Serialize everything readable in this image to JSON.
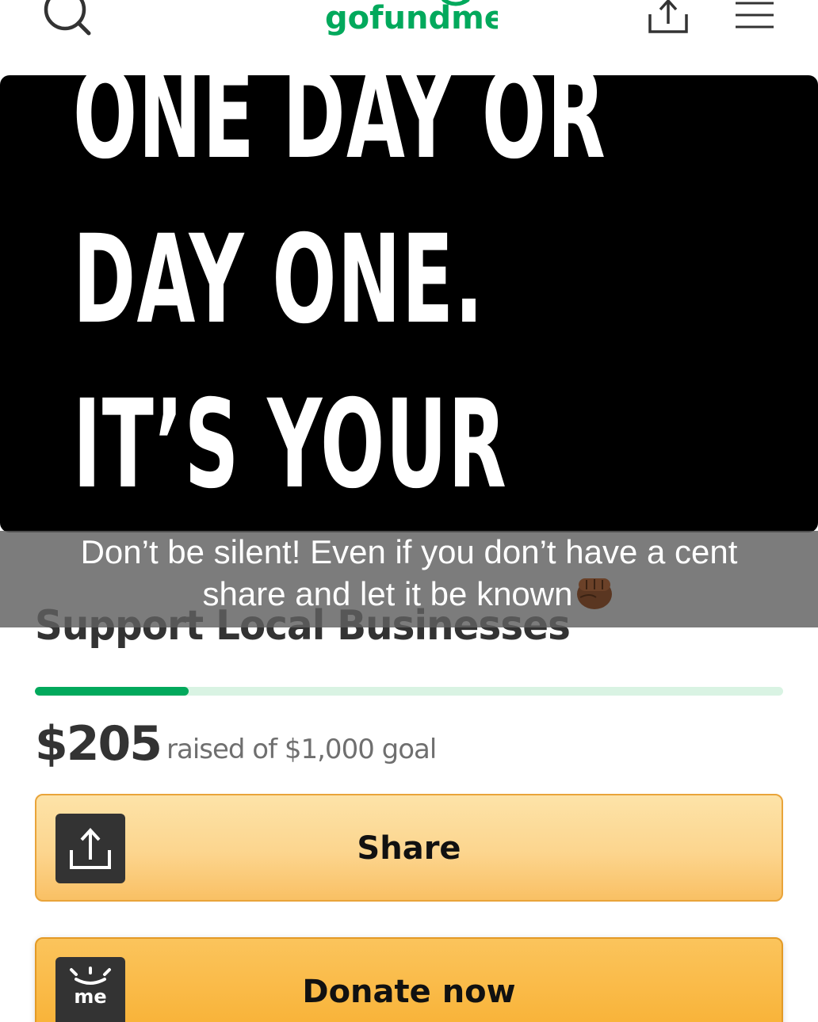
{
  "header": {
    "logo_text": "gofundme",
    "search_icon": "search-icon",
    "share_icon": "share-icon",
    "menu_icon": "hamburger-menu-icon"
  },
  "hero": {
    "lines": [
      "ONE DAY OR",
      "DAY ONE.",
      "IT’S YOUR"
    ]
  },
  "caption": {
    "line1": "Don’t be silent! Even if you don’t have a cent",
    "line2": "share and let it be known",
    "emoji": "raised-fist-emoji"
  },
  "campaign": {
    "title": "Support Local Businesses",
    "raised": "$205",
    "goal_text": "raised of $1,000 goal",
    "progress_fraction": 0.205
  },
  "buttons": {
    "share_label": "Share",
    "donate_label": "Donate now",
    "donate_icon_text": "me"
  },
  "colors": {
    "brand_green": "#02a95c",
    "progress_track": "#d9f3e3",
    "button_orange": "#f8af30"
  }
}
